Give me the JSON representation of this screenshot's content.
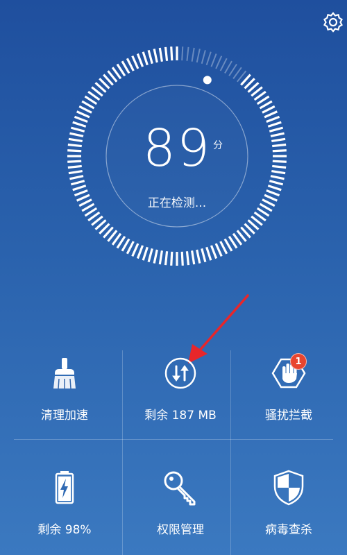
{
  "header": {
    "settings_icon": "gear-icon"
  },
  "gauge": {
    "score": "89",
    "unit": "分",
    "status": "正在检测...",
    "progress": 0.89
  },
  "tiles": {
    "clean_speedup": {
      "label": "清理加速",
      "icon": "broom-icon"
    },
    "data_remaining": {
      "label": "剩余 187 MB",
      "icon": "data-transfer-icon"
    },
    "harassment_block": {
      "label": "骚扰拦截",
      "icon": "hand-block-icon",
      "badge": "1"
    },
    "battery_remaining": {
      "label": "剩余 98%",
      "icon": "battery-icon",
      "level": 0.98
    },
    "permission_manage": {
      "label": "权限管理",
      "icon": "key-icon"
    },
    "virus_scan": {
      "label": "病毒查杀",
      "icon": "shield-icon"
    }
  },
  "colors": {
    "background_top": "#1f4f9e",
    "background_bottom": "#3b79c0",
    "badge": "#e8452e",
    "annotation_arrow": "#e8262a"
  }
}
